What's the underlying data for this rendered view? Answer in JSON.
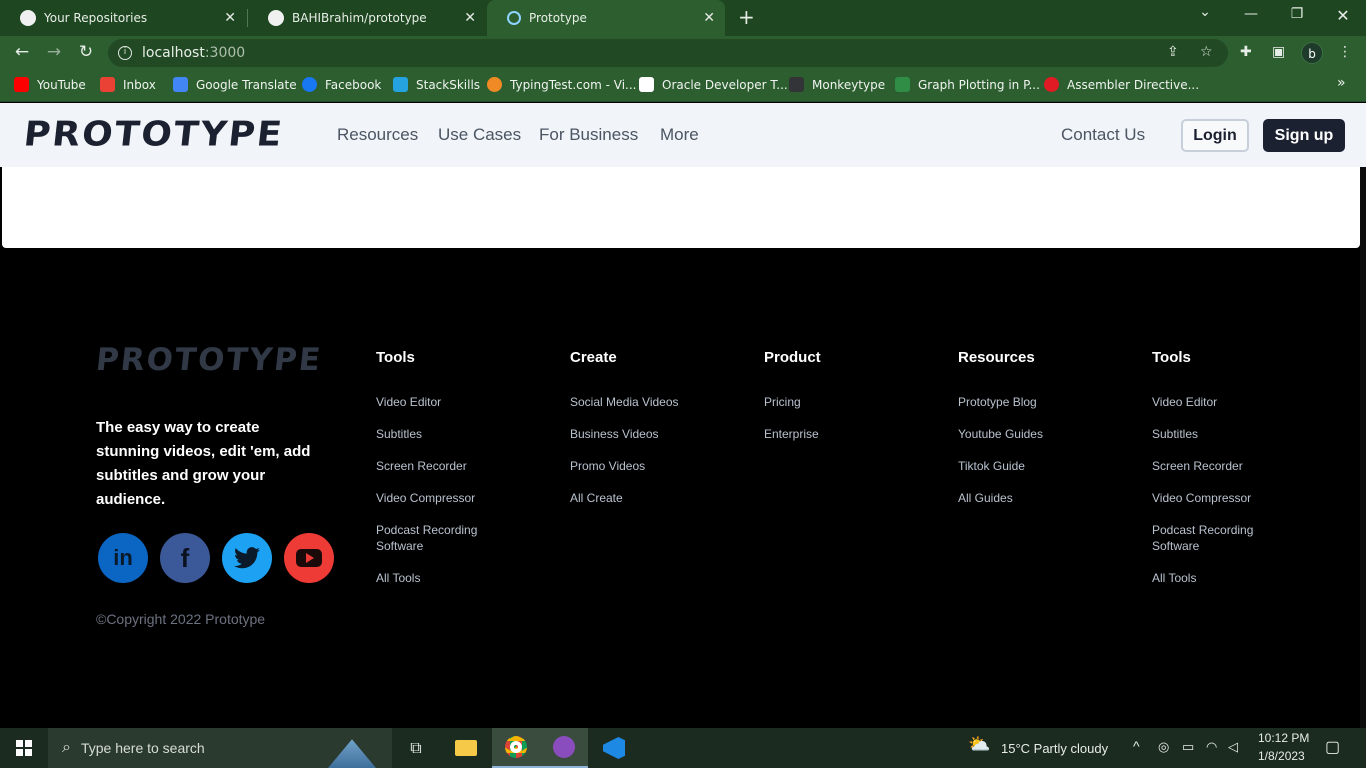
{
  "browser": {
    "tabs": [
      {
        "title": "Your Repositories"
      },
      {
        "title": "BAHIBrahim/prototype"
      },
      {
        "title": "Prototype"
      }
    ],
    "new_tab": "+",
    "url_host": "localhost",
    "url_port": ":3000",
    "profile_initial": "b",
    "bookmarks": [
      "YouTube",
      "Inbox",
      "Google Translate",
      "Facebook",
      "StackSkills",
      "TypingTest.com - Vi...",
      "Oracle Developer T...",
      "Monkeytype",
      "Graph Plotting in P...",
      "Assembler Directive..."
    ],
    "bookmarks_more": "»"
  },
  "site": {
    "logo": "PROTOTYPE",
    "nav": [
      "Resources",
      "Use Cases",
      "For Business",
      "More"
    ],
    "contact": "Contact Us",
    "login": "Login",
    "signup": "Sign up"
  },
  "footer": {
    "logo": "PROTOTYPE",
    "tagline": "The easy way to create stunning videos, edit 'em, add subtitles and grow your audience.",
    "copyright": "©Copyright 2022 Prototype",
    "social": [
      "linkedin-icon",
      "facebook-icon",
      "twitter-icon",
      "youtube-icon"
    ],
    "columns": [
      {
        "title": "Tools",
        "links": [
          "Video Editor",
          "Subtitles",
          "Screen Recorder",
          "Video Compressor",
          "Podcast Recording Software",
          "All Tools"
        ]
      },
      {
        "title": "Create",
        "links": [
          "Social Media Videos",
          "Business Videos",
          "Promo Videos",
          "All Create"
        ]
      },
      {
        "title": "Product",
        "links": [
          "Pricing",
          "Enterprise"
        ]
      },
      {
        "title": "Resources",
        "links": [
          "Prototype Blog",
          "Youtube Guides",
          "Tiktok Guide",
          "All Guides"
        ]
      },
      {
        "title": "Tools",
        "links": [
          "Video Editor",
          "Subtitles",
          "Screen Recorder",
          "Video Compressor",
          "Podcast Recording Software",
          "All Tools"
        ]
      }
    ]
  },
  "taskbar": {
    "search_placeholder": "Type here to search",
    "weather": "15°C  Partly cloudy",
    "time": "10:12 PM",
    "date": "1/8/2023"
  }
}
